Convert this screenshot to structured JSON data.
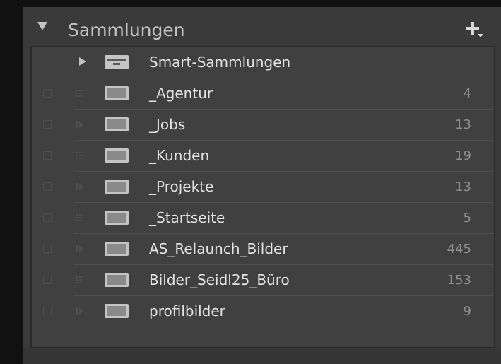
{
  "panel": {
    "title": "Sammlungen",
    "expanded": true,
    "add_icon": "plus-dropdown-icon"
  },
  "colors": {
    "panel_bg": "#3a3a3a",
    "list_bg": "#404040",
    "text": "#e2e2e2",
    "count_text": "#8f8f8f",
    "header_text": "#c2c2c2"
  },
  "smart_collections": {
    "label": "Smart-Sammlungen",
    "expanded": false
  },
  "collections": [
    {
      "name": "_Agentur",
      "count": "4"
    },
    {
      "name": "_Jobs",
      "count": "13"
    },
    {
      "name": "_Kunden",
      "count": "19"
    },
    {
      "name": "_Projekte",
      "count": "13"
    },
    {
      "name": "_Startseite",
      "count": "5"
    },
    {
      "name": "AS_Relaunch_Bilder",
      "count": "445"
    },
    {
      "name": "Bilder_Seidl25_Büro",
      "count": "153"
    },
    {
      "name": "profilbilder",
      "count": "9"
    }
  ]
}
